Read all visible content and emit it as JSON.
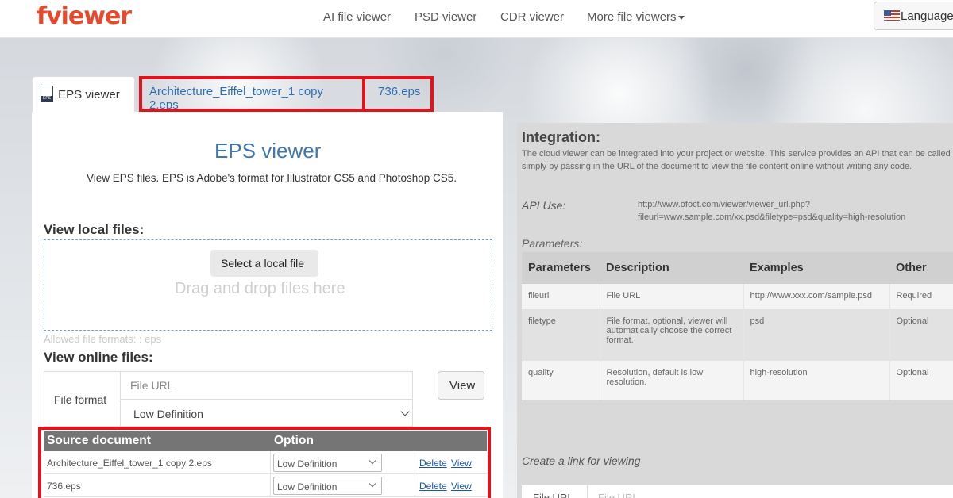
{
  "brand": {
    "logo_text_f": "f",
    "logo_text_rest": "viewer"
  },
  "nav": {
    "links": [
      "AI file viewer",
      "PSD viewer",
      "CDR viewer",
      "More file viewers"
    ],
    "language": "Language"
  },
  "tabs": {
    "active": "EPS viewer",
    "files": [
      "Architecture_Eiffel_tower_1 copy 2.eps",
      "736.eps"
    ]
  },
  "main": {
    "title": "EPS viewer",
    "subtitle": "View EPS files. EPS is Adobe's format for Illustrator CS5 and Photoshop CS5.",
    "local_heading": "View local files:",
    "select_button": "Select a local file",
    "drag_text": "Drag and drop files here",
    "allowed": "Allowed file formats: : eps",
    "online_heading": "View online files:",
    "file_format_label": "File format",
    "url_placeholder": "File URL",
    "quality_selected": "Low Definition",
    "view_button": "View"
  },
  "doc_table": {
    "headers": [
      "Source document",
      "Option"
    ],
    "rows": [
      {
        "name": "Architecture_Eiffel_tower_1 copy 2.eps",
        "option": "Low Definition",
        "delete": "Delete",
        "view": "View"
      },
      {
        "name": "736.eps",
        "option": "Low Definition",
        "delete": "Delete",
        "view": "View"
      }
    ]
  },
  "integration": {
    "title": "Integration:",
    "description": "The cloud viewer can be integrated into your project or website. This service provides an API that can be called simply by passing in the URL of the document to view the file content online without writing any code.",
    "api_label": "API Use:",
    "api_url_line1": "http://www.ofoct.com/viewer/viewer_url.php?",
    "api_url_line2": "fileurl=www.sample.com/xx.psd&filetype=psd&quality=high-resolution",
    "params_label": "Parameters:",
    "params_headers": [
      "Parameters",
      "Description",
      "Examples",
      "Other"
    ],
    "params_rows": [
      [
        "fileurl",
        "File URL",
        "http://www.xxx.com/sample.psd",
        "Required"
      ],
      [
        "filetype",
        "File format, optional, viewer will automatically choose the correct format.",
        "psd",
        "Optional"
      ],
      [
        "quality",
        "Resolution, default is low resolution.",
        "high-resolution",
        "Optional"
      ]
    ],
    "link_label": "Create a link for viewing",
    "bottom_label": "File URL",
    "bottom_placeholder": "File URL"
  }
}
